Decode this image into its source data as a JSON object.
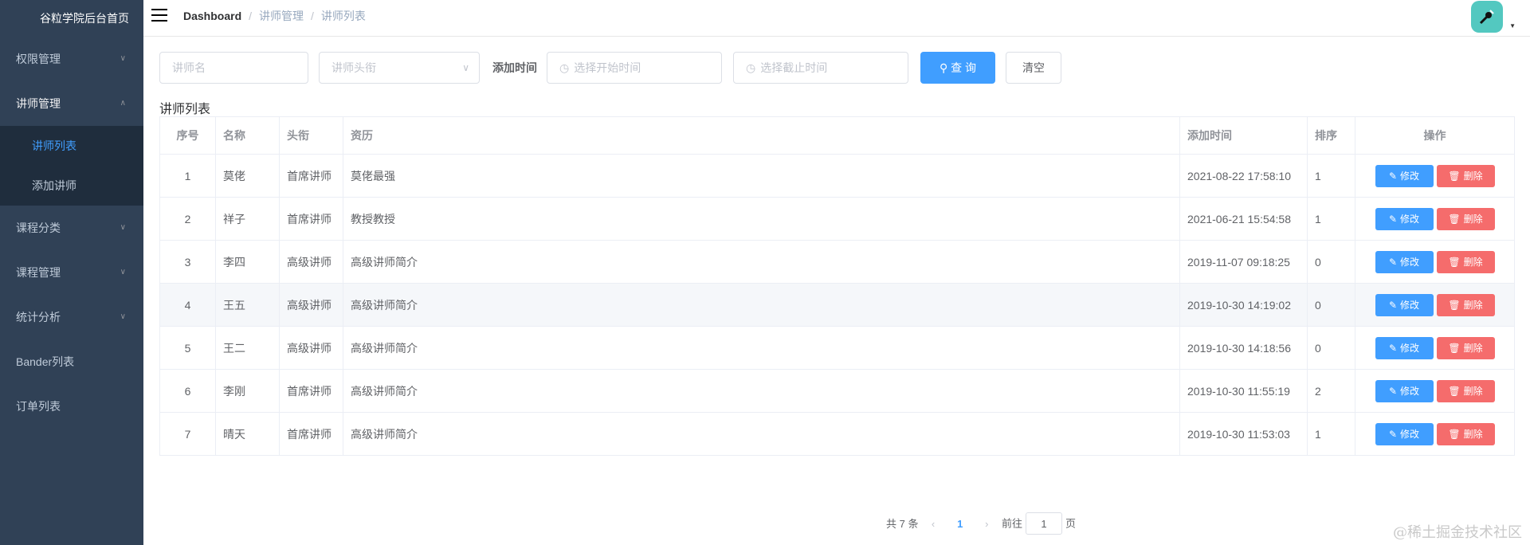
{
  "sidebar": {
    "brand": "谷粒学院后台首页",
    "menu": [
      {
        "label": "权限管理",
        "arrow": "⌄"
      },
      {
        "label": "讲师管理",
        "arrow": "⌃"
      },
      {
        "label": "课程分类",
        "arrow": "⌄"
      },
      {
        "label": "课程管理",
        "arrow": "⌄"
      },
      {
        "label": "统计分析",
        "arrow": "⌄"
      },
      {
        "label": "Bander列表"
      },
      {
        "label": "订单列表"
      }
    ],
    "submenu": [
      {
        "label": "讲师列表"
      },
      {
        "label": "添加讲师"
      }
    ]
  },
  "navbar": {
    "breadcrumb": [
      "Dashboard",
      "讲师管理",
      "讲师列表"
    ],
    "separator": "/"
  },
  "filters": {
    "name_placeholder": "讲师名",
    "level_placeholder": "讲师头衔",
    "time_label": "添加时间",
    "start_placeholder": "选择开始时间",
    "end_placeholder": "选择截止时间",
    "query_label": "查 询",
    "clear_label": "清空"
  },
  "list_title": "讲师列表",
  "table": {
    "headers": [
      "序号",
      "名称",
      "头衔",
      "资历",
      "添加时间",
      "排序",
      "操作"
    ],
    "edit_label": "修改",
    "delete_label": "删除",
    "rows": [
      {
        "index": "1",
        "name": "莫佬",
        "level": "首席讲师",
        "intro": "莫佬最强",
        "time": "2021-08-22 17:58:10",
        "sort": "1"
      },
      {
        "index": "2",
        "name": "祥子",
        "level": "首席讲师",
        "intro": "教授教授",
        "time": "2021-06-21 15:54:58",
        "sort": "1"
      },
      {
        "index": "3",
        "name": "李四",
        "level": "高级讲师",
        "intro": "高级讲师简介",
        "time": "2019-11-07 09:18:25",
        "sort": "0"
      },
      {
        "index": "4",
        "name": "王五",
        "level": "高级讲师",
        "intro": "高级讲师简介",
        "time": "2019-10-30 14:19:02",
        "sort": "0"
      },
      {
        "index": "5",
        "name": "王二",
        "level": "高级讲师",
        "intro": "高级讲师简介",
        "time": "2019-10-30 14:18:56",
        "sort": "0"
      },
      {
        "index": "6",
        "name": "李刚",
        "level": "首席讲师",
        "intro": "高级讲师简介",
        "time": "2019-10-30 11:55:19",
        "sort": "2"
      },
      {
        "index": "7",
        "name": "晴天",
        "level": "首席讲师",
        "intro": "高级讲师简介",
        "time": "2019-10-30 11:53:03",
        "sort": "1"
      }
    ]
  },
  "pagination": {
    "total": "共 7 条",
    "current": "1",
    "goto_prefix": "前往",
    "goto_value": "1",
    "goto_suffix": "页"
  },
  "watermark": "@稀土掘金技术社区",
  "colors": {
    "sidebar_bg": "#304156",
    "primary": "#409eff",
    "danger": "#f56c6c",
    "avatar": "#53c8c0"
  }
}
